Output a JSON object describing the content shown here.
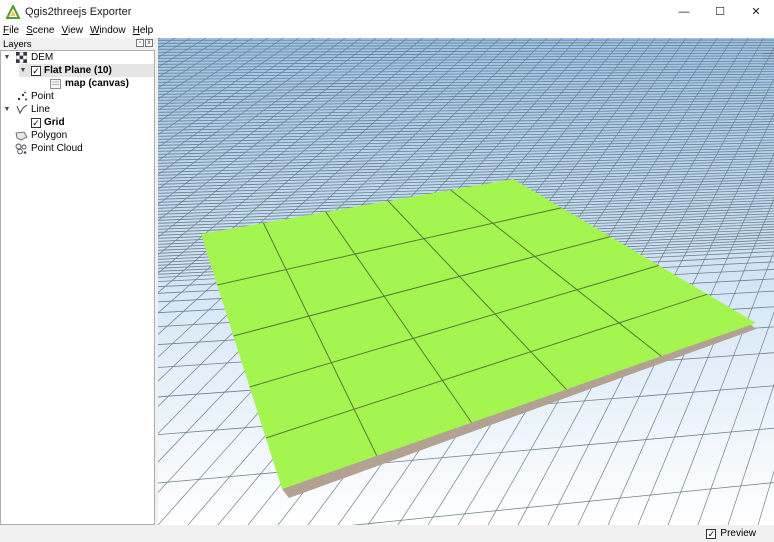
{
  "window": {
    "title": "Qgis2threejs Exporter",
    "minimize": "—",
    "maximize": "☐",
    "close": "✕"
  },
  "menu": [
    {
      "underline": "F",
      "rest": "ile"
    },
    {
      "underline": "S",
      "rest": "cene"
    },
    {
      "underline": "V",
      "rest": "iew"
    },
    {
      "underline": "W",
      "rest": "indow"
    },
    {
      "underline": "H",
      "rest": "elp"
    }
  ],
  "panel": {
    "title": "Layers",
    "float_btn": "▫",
    "close_btn": "x"
  },
  "tree": {
    "dem": {
      "label": "DEM",
      "icon": "dem-grid-icon"
    },
    "flat_plane": {
      "label": "Flat Plane (10)",
      "checked": "✓"
    },
    "map_canvas": {
      "label": "map (canvas)",
      "icon": "map-canvas-icon"
    },
    "point": {
      "label": "Point",
      "icon": "point-layer-icon"
    },
    "line": {
      "label": "Line",
      "icon": "line-layer-icon"
    },
    "grid": {
      "label": "Grid",
      "checked": "✓"
    },
    "polygon": {
      "label": "Polygon",
      "icon": "polygon-layer-icon"
    },
    "point_cloud": {
      "label": "Point Cloud",
      "icon": "point-cloud-layer-icon"
    }
  },
  "status": {
    "preview_label": "Preview",
    "preview_checked": "✓"
  },
  "colors": {
    "plane_top": "#a4f550",
    "plane_side": "#b3a293",
    "sky_top": "#9ac4e9",
    "ground": "#ffffff"
  }
}
